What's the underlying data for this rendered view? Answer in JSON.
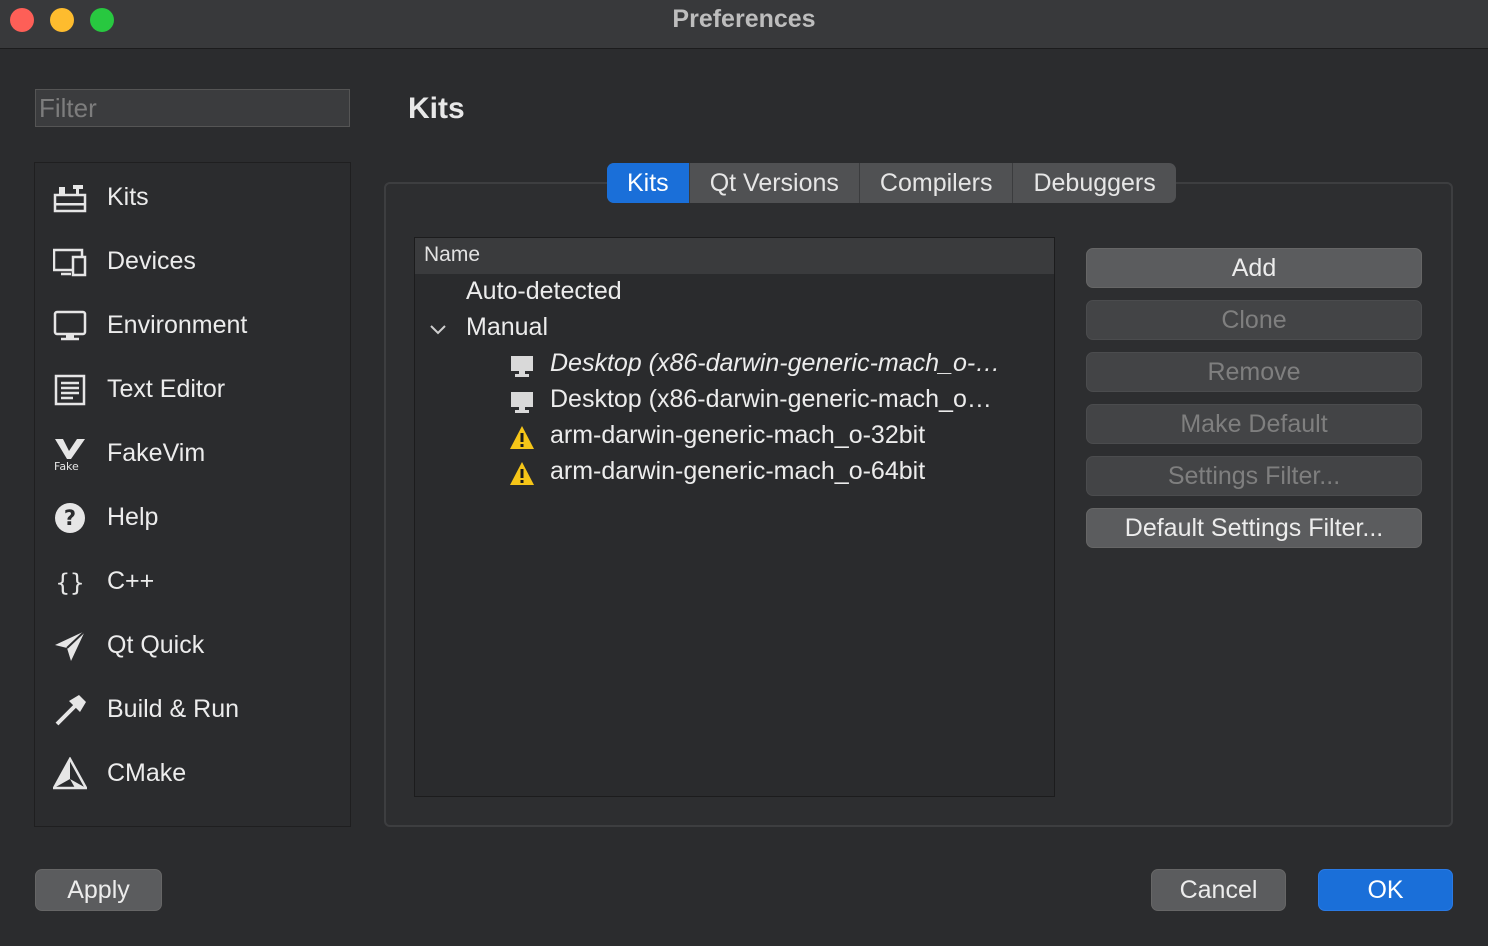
{
  "window": {
    "title": "Preferences"
  },
  "filter": {
    "placeholder": "Filter"
  },
  "sidebar": {
    "items": [
      {
        "label": "Kits",
        "icon": "kits-icon"
      },
      {
        "label": "Devices",
        "icon": "devices-icon"
      },
      {
        "label": "Environment",
        "icon": "monitor-icon"
      },
      {
        "label": "Text Editor",
        "icon": "text-editor-icon"
      },
      {
        "label": "FakeVim",
        "icon": "fakevim-icon"
      },
      {
        "label": "Help",
        "icon": "help-icon"
      },
      {
        "label": "C++",
        "icon": "braces-icon"
      },
      {
        "label": "Qt Quick",
        "icon": "paper-plane-icon"
      },
      {
        "label": "Build & Run",
        "icon": "hammer-icon"
      },
      {
        "label": "CMake",
        "icon": "cmake-icon"
      }
    ]
  },
  "page": {
    "title": "Kits"
  },
  "tabs": [
    {
      "label": "Kits",
      "active": true
    },
    {
      "label": "Qt Versions",
      "active": false
    },
    {
      "label": "Compilers",
      "active": false
    },
    {
      "label": "Debuggers",
      "active": false
    }
  ],
  "tree": {
    "header": "Name",
    "groups": [
      {
        "label": "Auto-detected"
      },
      {
        "label": "Manual",
        "expanded": true
      }
    ],
    "kits": [
      {
        "label": "Desktop (x86-darwin-generic-mach_o-…",
        "icon": "desktop-icon",
        "default": true
      },
      {
        "label": "Desktop (x86-darwin-generic-mach_o…",
        "icon": "desktop-icon",
        "default": false
      },
      {
        "label": "arm-darwin-generic-mach_o-32bit",
        "icon": "warning-icon",
        "default": false
      },
      {
        "label": "arm-darwin-generic-mach_o-64bit",
        "icon": "warning-icon",
        "default": false
      }
    ]
  },
  "actions": {
    "add": "Add",
    "clone": "Clone",
    "remove": "Remove",
    "make_default": "Make Default",
    "settings_filter": "Settings Filter...",
    "default_settings_filter": "Default Settings Filter..."
  },
  "footer": {
    "apply": "Apply",
    "cancel": "Cancel",
    "ok": "OK"
  },
  "colors": {
    "accent": "#1a6fd9",
    "warning": "#f5c518"
  }
}
